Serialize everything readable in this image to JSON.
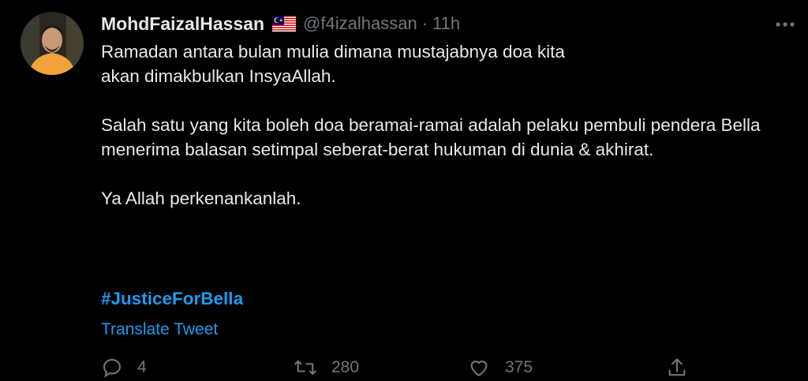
{
  "author": {
    "display_name": "MohdFaizalHassan",
    "handle": "@f4izalhassan",
    "separator": "·",
    "time": "11h"
  },
  "tweet": {
    "paragraphs": [
      "Ramadan antara bulan mulia dimana mustajabnya doa kita akan dimakbulkan InsyaAllah.",
      "Salah satu yang kita boleh doa beramai-ramai adalah pelaku pembuli pendera Bella menerima balasan setimpal seberat-berat hukuman di dunia & akhirat.",
      "Ya Allah perkenankanlah."
    ],
    "hashtag": "#JusticeForBella",
    "translate_label": "Translate Tweet"
  },
  "actions": {
    "reply_count": "4",
    "retweet_count": "280",
    "like_count": "375"
  },
  "icons": {
    "flag": "malaysia-flag-icon",
    "more": "more-dots-icon",
    "reply": "reply-bubble-icon",
    "retweet": "retweet-icon",
    "like": "heart-icon",
    "share": "share-icon"
  },
  "colors": {
    "background": "#000000",
    "text": "#e7e9ea",
    "muted": "#71767b",
    "link": "#1d9bf0"
  }
}
